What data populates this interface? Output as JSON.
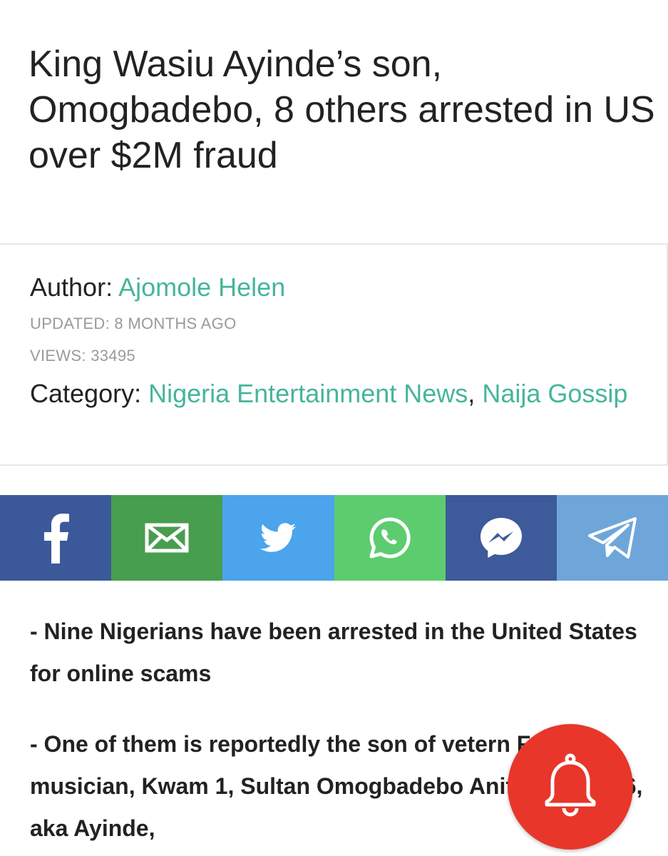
{
  "article": {
    "title": "King Wasiu Ayinde’s son, Omogbadebo, 8 others arrested in US over $2M fraud"
  },
  "meta": {
    "author_label": "Author:",
    "author_name": "Ajomole Helen",
    "updated": "UPDATED: 8 MONTHS AGO",
    "views": "VIEWS: 33495",
    "category_label": "Category:",
    "category_1": "Nigeria Entertainment News",
    "category_separator": ",",
    "category_2": "Naija Gossip",
    "link_color": "#46b59b"
  },
  "share": {
    "buttons": [
      {
        "icon": "facebook-icon",
        "color": "#3b5998"
      },
      {
        "icon": "email-icon",
        "color": "#479e4f"
      },
      {
        "icon": "twitter-icon",
        "color": "#4ba4ec"
      },
      {
        "icon": "whatsapp-icon",
        "color": "#5dcc6e"
      },
      {
        "icon": "messenger-icon",
        "color": "#3d5a9a"
      },
      {
        "icon": "telegram-icon",
        "color": "#6fa6da"
      }
    ]
  },
  "summary": {
    "point_1": "- Nine Nigerians have been arrested in the United States for online scams",
    "point_2": "- One of them is reportedly the son of vetern Fuji musician, Kwam 1, Sultan Omogbadebo Anifowoshe, 26, aka Ayinde,"
  },
  "notification": {
    "icon": "bell-icon",
    "color": "#e8362a"
  }
}
